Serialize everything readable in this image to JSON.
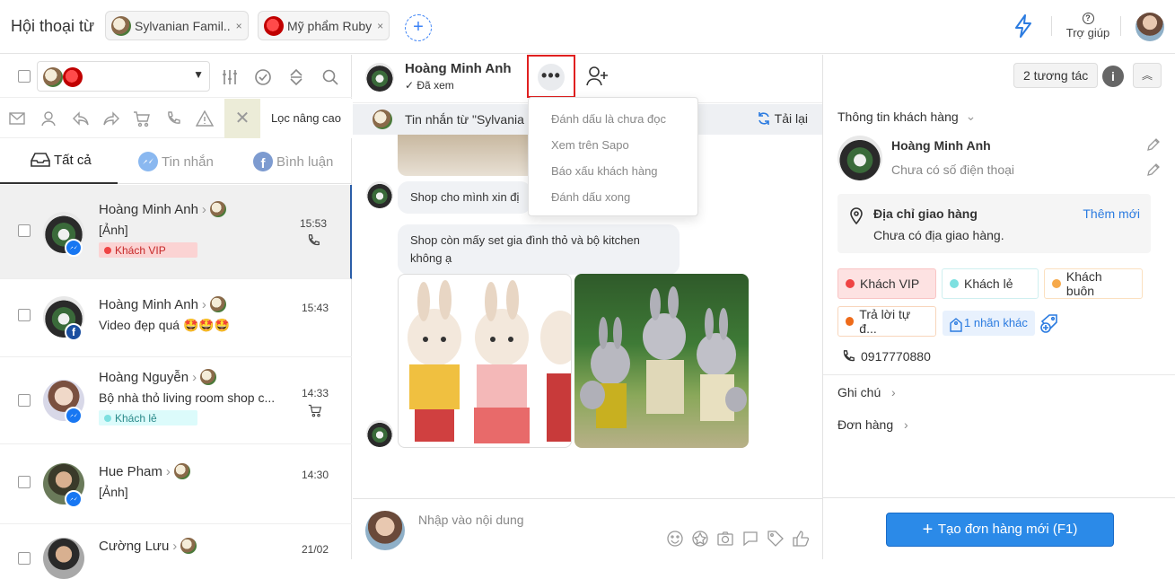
{
  "topbar": {
    "title": "Hội thoại từ",
    "tabs": [
      {
        "label": "Sylvanian Famil..",
        "close": "×"
      },
      {
        "label": "Mỹ phẩm Ruby",
        "close": "×"
      }
    ],
    "add_tab": "+",
    "help_label": "Trợ giúp"
  },
  "left": {
    "advanced_filter": "Lọc nâng cao",
    "tabs": [
      {
        "label": "Tất cả"
      },
      {
        "label": "Tin nhắn"
      },
      {
        "label": "Bình luận"
      }
    ],
    "conversations": [
      {
        "name": "Hoàng Minh Anh",
        "message": "[Ảnh]",
        "tag": "Khách VIP",
        "time": "15:53"
      },
      {
        "name": "Hoàng Minh Anh",
        "message": "Video đẹp quá 🤩🤩🤩",
        "time": "15:43"
      },
      {
        "name": "Hoàng Nguyễn",
        "message": "Bộ nhà thỏ living room shop c...",
        "tag": "Khách lẻ",
        "time": "14:33"
      },
      {
        "name": "Hue Pham",
        "message": "[Ảnh]",
        "time": "14:30"
      },
      {
        "name": "Cường Lưu",
        "time": "21/02"
      }
    ]
  },
  "chat": {
    "name": "Hoàng Minh Anh",
    "status": "Đã xem",
    "more": "•••",
    "interactions": "2 tương tác",
    "info": "i",
    "collapse": "︽",
    "banner": "Tin nhắn từ  \"Sylvania",
    "reload": "Tải lại",
    "messages": [
      "Shop cho mình xin đị",
      "Shop còn mấy set gia đình thỏ và bộ kitchen không ạ"
    ],
    "composer_placeholder": "Nhập vào nội dung",
    "menu": [
      "Đánh dấu là chưa đọc",
      "Xem trên Sapo",
      "Báo xấu khách hàng",
      "Đánh dấu xong"
    ]
  },
  "customer": {
    "header": "Thông tin khách hàng",
    "name": "Hoàng Minh Anh",
    "phone_placeholder": "Chưa có số điện thoại",
    "address_title": "Địa chỉ giao hàng",
    "address_add": "Thêm mới",
    "address_empty": "Chưa có địa giao hàng.",
    "tags": [
      {
        "label": "Khách VIP",
        "color": "#ef4444"
      },
      {
        "label": "Khách lẻ",
        "color": "#7de0e0"
      },
      {
        "label": "Khách buôn",
        "color": "#f6a94a"
      },
      {
        "label": "Trả lời tự đ...",
        "color": "#ee6b1a"
      }
    ],
    "more_tags": "1 nhãn khác",
    "phone": "0917770880",
    "note_section": "Ghi chú",
    "order_section": "Đơn hàng",
    "create_order": "Tạo đơn hàng mới (F1)"
  },
  "colors": {
    "accent": "#2b8ae8",
    "vip": "#ef4444",
    "highlight": "#e02020"
  }
}
